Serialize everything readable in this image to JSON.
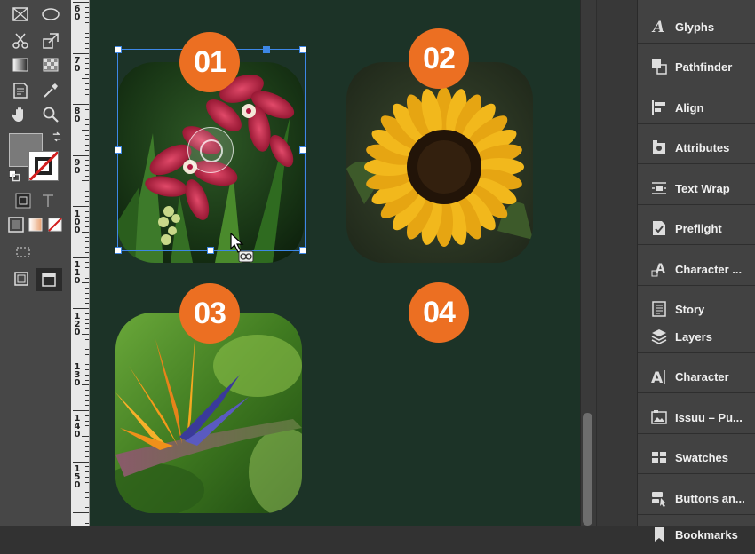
{
  "panel": {
    "items": [
      {
        "label": "Glyphs",
        "icon": "glyphs-icon"
      },
      {
        "label": "Pathfinder",
        "icon": "pathfinder-icon"
      },
      {
        "label": "Align",
        "icon": "align-icon"
      },
      {
        "label": "Attributes",
        "icon": "attributes-icon"
      },
      {
        "label": "Text Wrap",
        "icon": "text-wrap-icon"
      },
      {
        "label": "Preflight",
        "icon": "preflight-icon"
      },
      {
        "label": "Character ...",
        "icon": "character-styles-icon"
      },
      {
        "label": "Story",
        "icon": "story-icon"
      },
      {
        "label": "Layers",
        "icon": "layers-icon"
      },
      {
        "label": "Character",
        "icon": "character-icon"
      },
      {
        "label": "Issuu – Pu...",
        "icon": "issuu-icon"
      },
      {
        "label": "Swatches",
        "icon": "swatches-icon"
      },
      {
        "label": "Buttons an...",
        "icon": "buttons-icon"
      },
      {
        "label": "Bookmarks",
        "icon": "bookmarks-icon"
      }
    ]
  },
  "ruler": {
    "labels": [
      "60",
      "70",
      "80",
      "90",
      "100",
      "110",
      "120",
      "130",
      "140",
      "150"
    ]
  },
  "canvas": {
    "badges": [
      "01",
      "02",
      "03",
      "04"
    ],
    "images": [
      "red orchid flowers",
      "sunflower",
      "bird of paradise flower"
    ]
  },
  "colors": {
    "accent": "#ec6f22",
    "canvas": "#1c3327",
    "selection": "#3d87e6"
  }
}
